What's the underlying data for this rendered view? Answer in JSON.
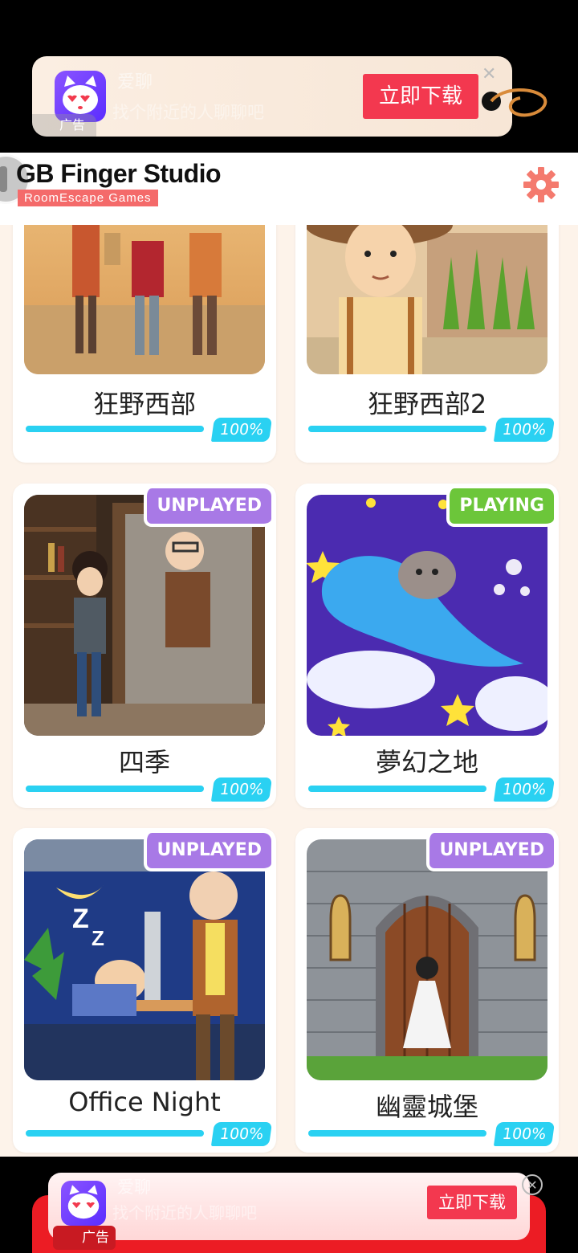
{
  "ad_top": {
    "app_name": "爱聊",
    "description": "找个附近的人聊聊吧",
    "download_label": "立即下载",
    "tag": "广告",
    "close_glyph": "✕"
  },
  "header": {
    "brand_title": "GB Finger Studio",
    "brand_subtitle": "RoomEscape Games"
  },
  "games": [
    {
      "title": "狂野西部",
      "percent": "100%",
      "progress": 1.0,
      "badge": "",
      "thumb": "wild-west"
    },
    {
      "title": "狂野西部2",
      "percent": "100%",
      "progress": 1.0,
      "badge": "",
      "thumb": "wild-west-2"
    },
    {
      "title": "四季",
      "percent": "100%",
      "progress": 1.0,
      "badge": "UNPLAYED",
      "thumb": "four-seasons"
    },
    {
      "title": "夢幻之地",
      "percent": "100%",
      "progress": 1.0,
      "badge": "PLAYING",
      "thumb": "dreamland"
    },
    {
      "title": "Office Night",
      "percent": "100%",
      "progress": 1.0,
      "badge": "UNPLAYED",
      "thumb": "office-night"
    },
    {
      "title": "幽靈城堡",
      "percent": "100%",
      "progress": 1.0,
      "badge": "UNPLAYED",
      "thumb": "ghost-castle"
    }
  ],
  "ad_bottom": {
    "app_name": "爱聊",
    "description": "找个附近的人聊聊吧",
    "download_label": "立即下载",
    "tag": "广告",
    "close_glyph": "✕"
  },
  "colors": {
    "accent_progress": "#2ad1f2",
    "badge_unplayed": "#a879e6",
    "badge_playing": "#6cc63a",
    "settings_gear": "#f47a6e",
    "download_button": "#f3384f"
  }
}
